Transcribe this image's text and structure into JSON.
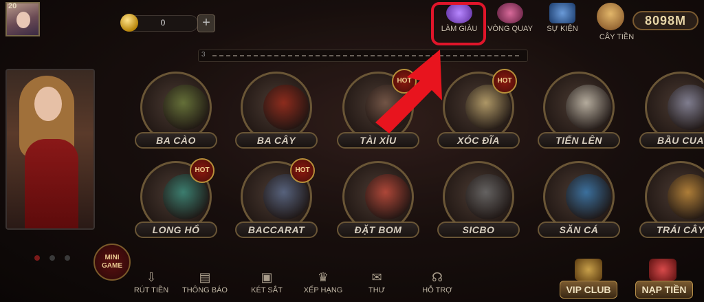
{
  "profile": {
    "level": "20"
  },
  "wallet": {
    "balance": "0",
    "add_label": "+"
  },
  "topnav": [
    {
      "id": "lam-giau",
      "label": "LÀM GIÀU",
      "color": "#8a5ad0"
    },
    {
      "id": "vong-quay",
      "label": "VÒNG QUAY",
      "color": "#a03a6a"
    },
    {
      "id": "su-kien",
      "label": "SỰ KIỆN",
      "color": "#3a6ab0"
    },
    {
      "id": "cay-tien",
      "label": "CÂY TIỀN",
      "color": "#c08a3a"
    }
  ],
  "jackpot": {
    "value": "8098M"
  },
  "marquee": {
    "text": "3"
  },
  "mini_game": {
    "line1": "MINI",
    "line2": "GAME"
  },
  "games": [
    {
      "label": "BA CÀO",
      "hot": false,
      "color": "#6a7a3a"
    },
    {
      "label": "BA CÂY",
      "hot": false,
      "color": "#9a2a1a"
    },
    {
      "label": "TÀI XỈU",
      "hot": true,
      "color": "#7a5a4a"
    },
    {
      "label": "XÓC ĐĨA",
      "hot": true,
      "color": "#c0a870"
    },
    {
      "label": "TIẾN LÊN",
      "hot": false,
      "color": "#c8c0b0"
    },
    {
      "label": "BẦU CUA",
      "hot": false,
      "color": "#8a8aa0"
    },
    {
      "label": "LONG HỔ",
      "hot": true,
      "color": "#3a8a7a"
    },
    {
      "label": "BACCARAT",
      "hot": true,
      "color": "#5a6a8a"
    },
    {
      "label": "ĐẶT BOM",
      "hot": false,
      "color": "#c04a3a"
    },
    {
      "label": "SICBO",
      "hot": false,
      "color": "#6a6a6a"
    },
    {
      "label": "SĂN CÁ",
      "hot": false,
      "color": "#3a7ab0"
    },
    {
      "label": "TRÁI CÂY",
      "hot": false,
      "color": "#c08a3a"
    }
  ],
  "hot_label": "HOT",
  "bottom_nav": [
    {
      "label": "RÚT TIỀN",
      "icon": "withdraw-icon"
    },
    {
      "label": "THÔNG BÁO",
      "icon": "notice-board-icon"
    },
    {
      "label": "KÉT SẮT",
      "icon": "safe-icon"
    },
    {
      "label": "XẾP HẠNG",
      "icon": "crown-icon"
    },
    {
      "label": "THƯ",
      "icon": "mail-icon"
    },
    {
      "label": "HỖ TRỢ",
      "icon": "headset-icon"
    }
  ],
  "vip_button": "VIP CLUB",
  "deposit_button": "NẠP TIỀN",
  "colors": {
    "highlight": "#e0152a",
    "arrow": "#e8141e"
  }
}
